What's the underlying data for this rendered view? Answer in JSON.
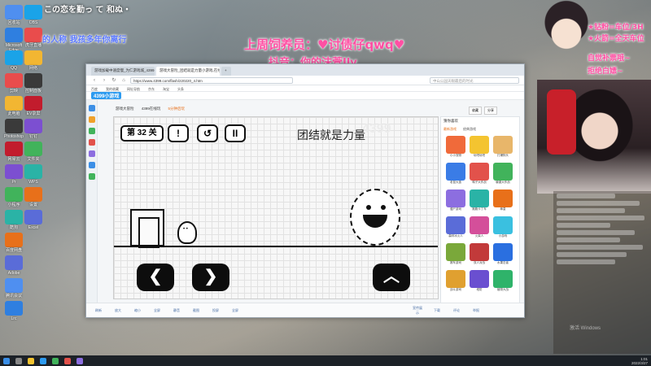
{
  "overlay": {
    "top_left_line1": "この恋を勤っ て 和ぬ・",
    "top_left_line2": "的人称 我孩多年你离行",
    "top_center_line1": "上周饲养员：♥讨债仔qwq♥",
    "top_center_line2": "抖音：你的沫萱Jly",
    "right_line1": "★钻粉=车位/3H",
    "right_line2": "★火箭=全天车位",
    "right_line3": "自觉补票哦~",
    "right_line4": "拒绝白嫖~"
  },
  "desktop_icons": [
    "回收站",
    "Microsoft Edge",
    "QQ",
    "剪映",
    "此电脑",
    "Photoshop",
    "网易云",
    "Pr",
    "小程序",
    "酷狗",
    "百度网盘",
    "Adobe",
    "腾讯会议",
    "Lrc",
    "OBS",
    "虎牙直播",
    "网络",
    "控制面板",
    "EV录屏",
    "钉钉",
    "文件夹",
    "WPS",
    "设置",
    "Excel"
  ],
  "browser": {
    "tabs": [
      "游戏加载中速度慢_为仁游戏城_4399...",
      "游戏大冒险_团结就是力量小游戏,在线...",
      ""
    ],
    "url": "https://www.4399.com/flash/220220_4.htm",
    "search_placeholder": "中山公园天眼最后的时光",
    "bookmarks": [
      "百度",
      "我的收藏",
      "网址导航",
      "京东",
      "淘宝",
      "头条"
    ],
    "site_logo": "4399小游戏",
    "game_title": "游戏大冒险",
    "game_meta": "4399在线玩",
    "game_meta2": "5分钟后玩",
    "fav_label": "收藏",
    "share_label": "分享"
  },
  "game": {
    "level": "第 32 关",
    "hint_text": "团结就是力量",
    "watermark": "4399",
    "help_btn": "!",
    "restart_btn": "↺",
    "pause_btn": "II",
    "left_btn": "❮",
    "right_btn": "❯",
    "jump_btn": "︿"
  },
  "right_panel": {
    "title": "猜你喜欢",
    "tab_active": "最新游戏",
    "tab_other": "经典游戏",
    "games": [
      "小小宠物",
      "玩吧玩吧",
      "打爆狗头",
      "老鼠大逃",
      "鸭子大作战",
      "躲避大作战",
      "僵尸游戏",
      "跑跑卡丁车",
      "拳皇",
      "森林冰火人",
      "火柴人",
      "小游戏",
      "赛车游戏",
      "双人对战",
      "水果忍者",
      "战斗游戏",
      "塔防",
      "植物大战"
    ]
  },
  "bottom_bar": [
    "刷新",
    "放大",
    "缩小",
    "全屏",
    "静音",
    "截图",
    "投屏",
    "全屏",
    "宣传展示",
    "下载",
    "评论",
    "举报"
  ],
  "taskbar": {
    "time": "1:01",
    "date": "2022/3/27"
  },
  "windows_watermark": "激活 Windows",
  "colors": {
    "browser_accent": "#2d9bf0",
    "overlay_blue": "#5a78ff",
    "overlay_pink": "#ff4fa3"
  }
}
